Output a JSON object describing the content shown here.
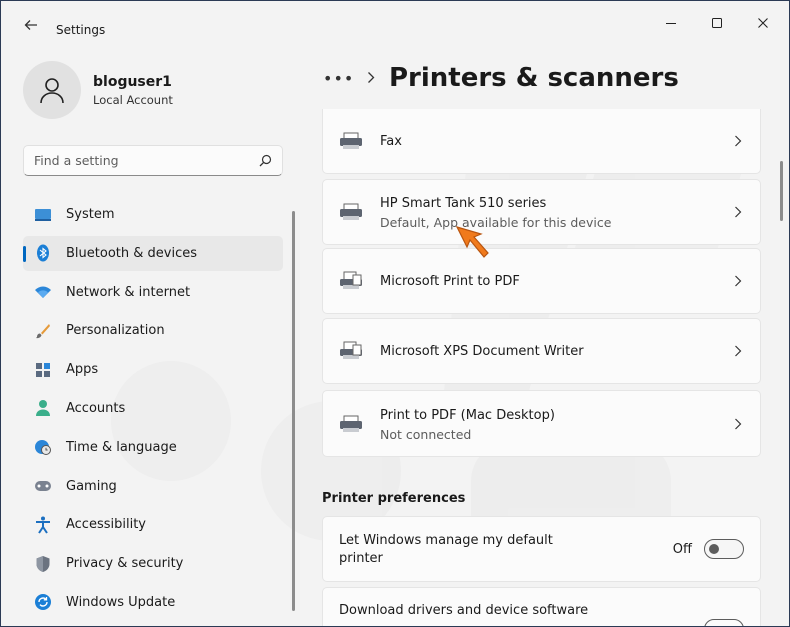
{
  "window": {
    "title": "Settings"
  },
  "profile": {
    "name": "bloguser1",
    "account_type": "Local Account"
  },
  "search": {
    "placeholder": "Find a setting"
  },
  "sidebar": {
    "items": [
      {
        "label": "System",
        "icon": "monitor-icon"
      },
      {
        "label": "Bluetooth & devices",
        "icon": "bluetooth-icon",
        "active": true
      },
      {
        "label": "Network & internet",
        "icon": "wifi-icon"
      },
      {
        "label": "Personalization",
        "icon": "brush-icon"
      },
      {
        "label": "Apps",
        "icon": "apps-icon"
      },
      {
        "label": "Accounts",
        "icon": "person-icon"
      },
      {
        "label": "Time & language",
        "icon": "globe-clock-icon"
      },
      {
        "label": "Gaming",
        "icon": "gamepad-icon"
      },
      {
        "label": "Accessibility",
        "icon": "accessibility-icon"
      },
      {
        "label": "Privacy & security",
        "icon": "shield-icon"
      },
      {
        "label": "Windows Update",
        "icon": "update-icon"
      }
    ]
  },
  "breadcrumb": {
    "more": "•••",
    "current": "Printers & scanners"
  },
  "printers": [
    {
      "name": "Fax",
      "status": ""
    },
    {
      "name": "HP Smart Tank 510 series",
      "status": "Default, App available for this device"
    },
    {
      "name": "Microsoft Print to PDF",
      "status": ""
    },
    {
      "name": "Microsoft XPS Document Writer",
      "status": ""
    },
    {
      "name": "Print to PDF (Mac Desktop)",
      "status": "Not connected"
    }
  ],
  "preferences": {
    "heading": "Printer preferences",
    "manage_default": {
      "label": "Let Windows manage my default printer",
      "toggle_label": "Off",
      "value": false
    },
    "download_drivers": {
      "label": "Download drivers and device software"
    }
  },
  "colors": {
    "accent": "#0067c0",
    "arrow": "#f07a1c",
    "background": "#f3f3f3",
    "card": "#fbfbfb"
  }
}
